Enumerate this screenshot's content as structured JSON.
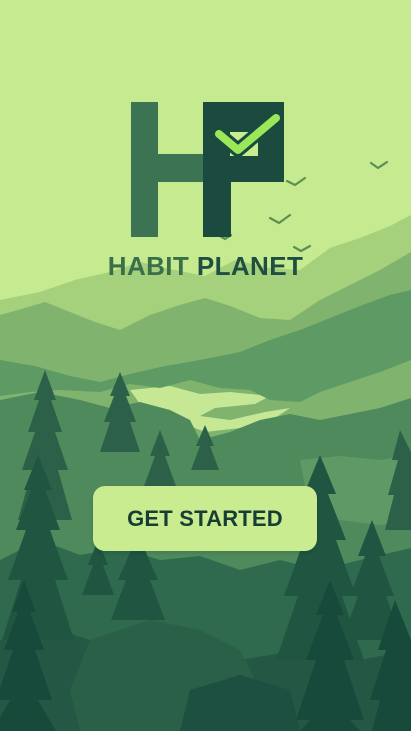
{
  "app": {
    "logo_name": "habit-planet-logo",
    "brand_word_1": "HABIT",
    "brand_word_2": "PLANET"
  },
  "actions": {
    "get_started_label": "GET STARTED"
  },
  "colors": {
    "background": "#c5ea8f",
    "logo_dark": "#1b4a3e",
    "logo_light": "#3c7352",
    "check_accent": "#9be75a",
    "button_bg": "#c8ec8f",
    "button_text": "#183d35"
  }
}
